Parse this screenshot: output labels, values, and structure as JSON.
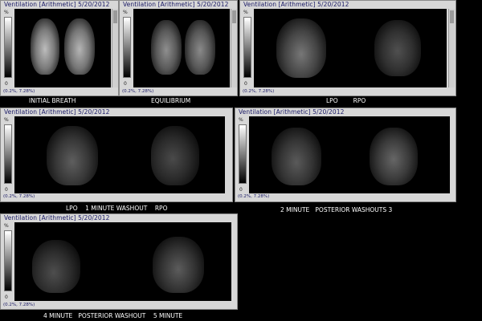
{
  "panels": [
    {
      "title": "Ventilation [Arithmetic] 5/20/2012",
      "scale_max": "58",
      "scale_min": "0",
      "range": "(0.2%, 7.28%)"
    },
    {
      "title": "Ventilation [Arithmetic] 5/20/2012",
      "scale_max": "50",
      "scale_min": "0",
      "range": "(0.2%, 7.28%)"
    },
    {
      "title": "Ventilation [Arithmetic] 5/20/2012",
      "scale_max": "30",
      "scale_min": "0",
      "range": "(0.2%, 7.28%)"
    },
    {
      "title": "Ventilation [Arithmetic] 5/20/2012",
      "scale_max": "30",
      "scale_min": "0",
      "range": "(0.2%, 7.28%)"
    },
    {
      "title": "Ventilation [Arithmetic] 5/20/2012",
      "scale_max": "30",
      "scale_min": "0",
      "range": "(0.2%, 7.28%)"
    },
    {
      "title": "Ventilation [Arithmetic] 5/20/2012",
      "scale_max": "30",
      "scale_min": "0",
      "range": "(0.2%, 7.28%)"
    }
  ],
  "scale_unit": "%",
  "captions": {
    "initial_breath": "INITIAL BREATH",
    "equilibrium": "EQUILIBRIUM",
    "lpo_rpo": "LPO        RPO",
    "washout_1min": "LPO    1 MINUTE WASHOUT    RPO",
    "washout_2min": "2 MINUTE   POSTERIOR WASHOUTS 3",
    "washout_4min": "4 MINUTE   POSTERIOR WASHOUT    5 MINUTE"
  }
}
